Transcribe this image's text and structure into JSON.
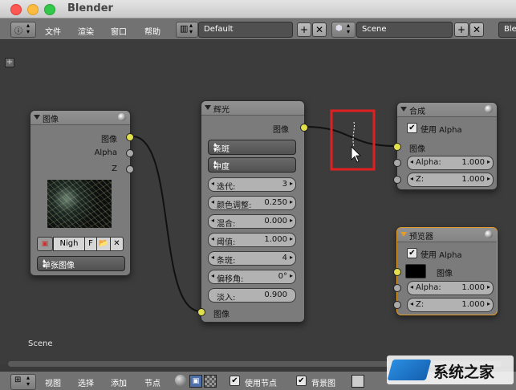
{
  "app": {
    "title": "Blender"
  },
  "header": {
    "menus": [
      "文件",
      "渲染",
      "窗口",
      "帮助"
    ],
    "layout": "Default",
    "scene": "Scene",
    "engine": "Ble"
  },
  "editor": {
    "scene_label": "Scene"
  },
  "nodes": {
    "image": {
      "title": "图像",
      "outputs": [
        "图像",
        "Alpha",
        "Z"
      ],
      "image_name": "Nigh",
      "fake_user": "F",
      "source": "单张图像"
    },
    "glare": {
      "title": "辉光",
      "output": "图像",
      "type": "条斑",
      "quality": "中度",
      "fields": [
        {
          "label": "迭代:",
          "value": "3"
        },
        {
          "label": "颜色调整:",
          "value": "0.250"
        },
        {
          "label": "混合:",
          "value": "0.000"
        },
        {
          "label": "阈值:",
          "value": "1.000"
        },
        {
          "label": "条斑:",
          "value": "4"
        },
        {
          "label": "偏移角:",
          "value": "0°"
        },
        {
          "label": "淡入:",
          "value": "0.900"
        }
      ],
      "input": "图像"
    },
    "composite": {
      "title": "合成",
      "use_alpha": "使用 Alpha",
      "input": "图像",
      "alpha_label": "Alpha:",
      "alpha_value": "1.000",
      "z_label": "Z:",
      "z_value": "1.000"
    },
    "viewer": {
      "title": "预览器",
      "use_alpha": "使用 Alpha",
      "input": "图像",
      "alpha_label": "Alpha:",
      "alpha_value": "1.000",
      "z_label": "Z:",
      "z_value": "1.000"
    }
  },
  "footer": {
    "menus": [
      "视图",
      "选择",
      "添加",
      "节点"
    ],
    "use_nodes": "使用节点",
    "backdrop": "背景图"
  },
  "watermark": "系统之家",
  "colors": {
    "accent": "#e1e04c",
    "highlight": "#e02020",
    "viewer_border": "#e39b2a"
  }
}
